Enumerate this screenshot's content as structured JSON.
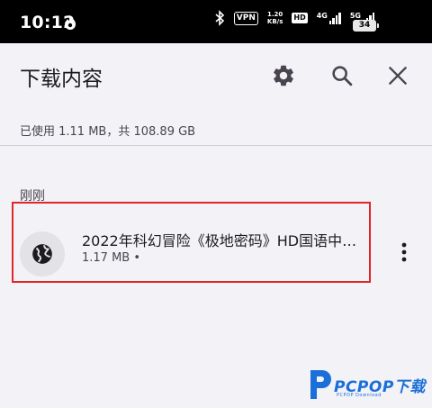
{
  "status_bar": {
    "time": "10:12",
    "vpn": "VPN",
    "net_speed_value": "1.20",
    "net_speed_unit": "KB/s",
    "hd": "HD",
    "signal1": "4G",
    "signal2": "5G",
    "battery": "34"
  },
  "header": {
    "title": "下载内容",
    "settings_icon": "gear-icon",
    "search_icon": "search-icon",
    "close_icon": "close-icon"
  },
  "storage": {
    "summary": "已使用 1.11 MB，共 108.89 GB"
  },
  "section": {
    "label": "刚刚"
  },
  "downloads": [
    {
      "title": "2022年科幻冒险《极地密码》HD国语中…",
      "meta": "1.17 MB •",
      "icon": "globe-icon"
    }
  ],
  "watermark": {
    "text": "PCPOP下载",
    "sub": "PCPOP Download"
  },
  "colors": {
    "highlight": "#e0262b",
    "watermark": "#1a6fd9"
  }
}
